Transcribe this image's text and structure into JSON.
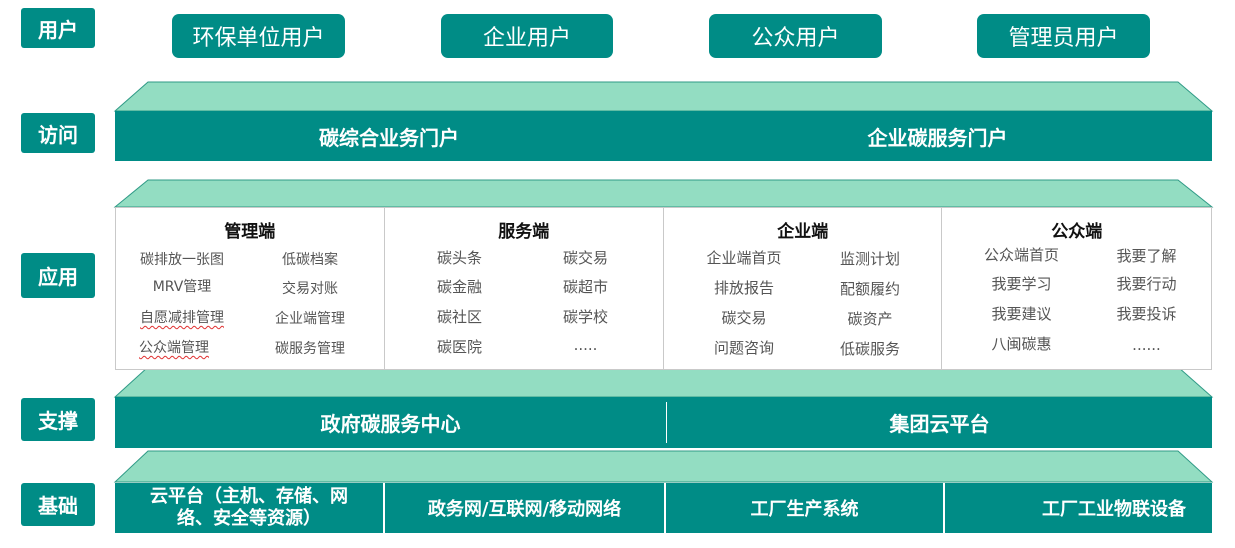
{
  "layers": {
    "user": "用户",
    "access": "访问",
    "application": "应用",
    "support": "支撑",
    "foundation": "基础"
  },
  "users": [
    "环保单位用户",
    "企业用户",
    "公众用户",
    "管理员用户"
  ],
  "access": {
    "left": "碳综合业务门户",
    "right": "企业碳服务门户"
  },
  "apps": [
    {
      "title": "管理端",
      "items": [
        "碳排放一张图",
        "低碳档案",
        "MRV管理",
        "交易对账",
        "自愿减排管理",
        "企业端管理",
        "公众端管理",
        "碳服务管理"
      ]
    },
    {
      "title": "服务端",
      "items": [
        "碳头条",
        "碳交易",
        "碳金融",
        "碳超市",
        "碳社区",
        "碳学校",
        "碳医院",
        "....."
      ]
    },
    {
      "title": "企业端",
      "items": [
        "企业端首页",
        "监测计划",
        "排放报告",
        "配额履约",
        "碳交易",
        "碳资产",
        "问题咨询",
        "低碳服务"
      ]
    },
    {
      "title": "公众端",
      "items": [
        "公众端首页",
        "我要了解",
        "我要学习",
        "我要行动",
        "我要建议",
        "我要投诉",
        "八闽碳惠",
        "......"
      ]
    }
  ],
  "support": {
    "left": "政府碳服务中心",
    "right": "集团云平台"
  },
  "foundation": [
    "云平台（主机、存储、网络、安全等资源）",
    "政务网/互联网/移动网络",
    "工厂生产系统",
    "工厂工业物联设备"
  ],
  "colors": {
    "teal": "#008C86",
    "mint": "#93DDC2",
    "wavy_underline": "#e03030"
  }
}
